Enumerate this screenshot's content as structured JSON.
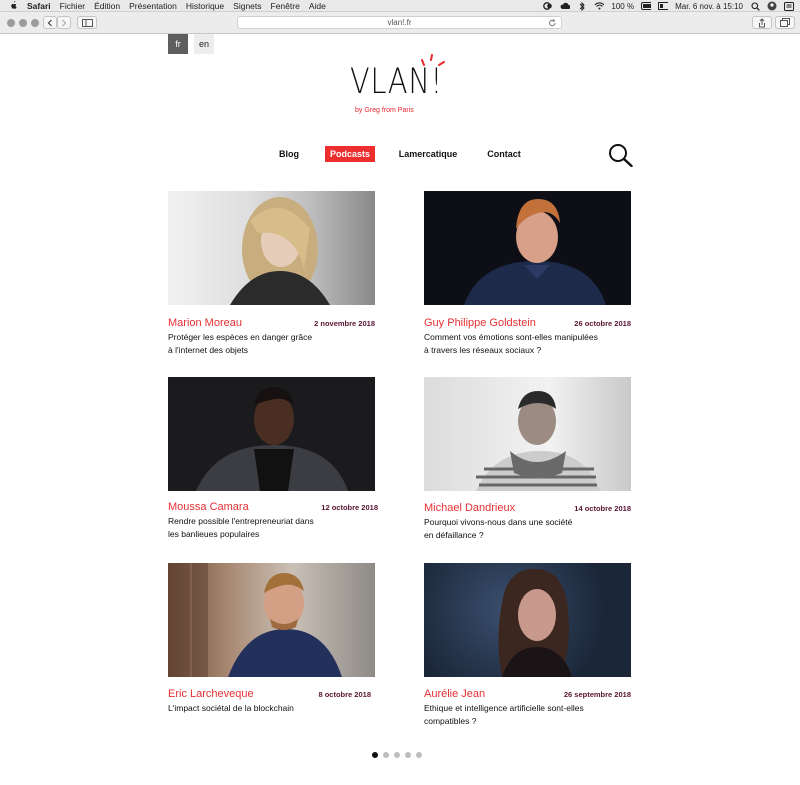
{
  "menubar": {
    "app": "Safari",
    "items": [
      "Fichier",
      "Édition",
      "Présentation",
      "Historique",
      "Signets",
      "Fenêtre",
      "Aide"
    ],
    "battery": "100 %",
    "datetime": "Mar. 6 nov. à 15:10"
  },
  "browser": {
    "url": "vlan!.fr"
  },
  "languages": [
    "fr",
    "en"
  ],
  "logo": {
    "word": "VLAN!",
    "tagline": "by Greg from Paris"
  },
  "nav": [
    {
      "label": "Blog"
    },
    {
      "label": "Podcasts",
      "active": true
    },
    {
      "label": "Lamercatique"
    },
    {
      "label": "Contact"
    }
  ],
  "cards": [
    {
      "name": "Marion Moreau",
      "date": "2 novembre 2018",
      "desc1": "Protéger les espèces en danger grâce",
      "desc2": "à l'internet des objets"
    },
    {
      "name": "Guy Philippe Goldstein",
      "date": "26 octobre 2018",
      "desc1": "Comment vos émotions sont-elles manipulées",
      "desc2": "à travers les réseaux sociaux ?"
    },
    {
      "name": "Moussa Camara",
      "date": "12 octobre 2018",
      "desc1": "Rendre possible l'entrepreneuriat dans",
      "desc2": "les banlieues populaires"
    },
    {
      "name": "Michael Dandrieux",
      "date": "14 octobre 2018",
      "desc1": "Pourquoi vivons-nous dans une société",
      "desc2": "en défaillance ?"
    },
    {
      "name": "Eric Larcheveque",
      "date": "8 octobre 2018",
      "desc1": "L'impact sociétal de la blockchain",
      "desc2": ""
    },
    {
      "name": "Aurélie Jean",
      "date": "26 septembre 2018",
      "desc1": "Ethique et intelligence artificielle sont-elles",
      "desc2": "compatibles ?"
    }
  ],
  "pager": {
    "pages": 5,
    "current": 1
  },
  "colors": {
    "accent": "#ec2e2e",
    "date": "#5a1533"
  }
}
